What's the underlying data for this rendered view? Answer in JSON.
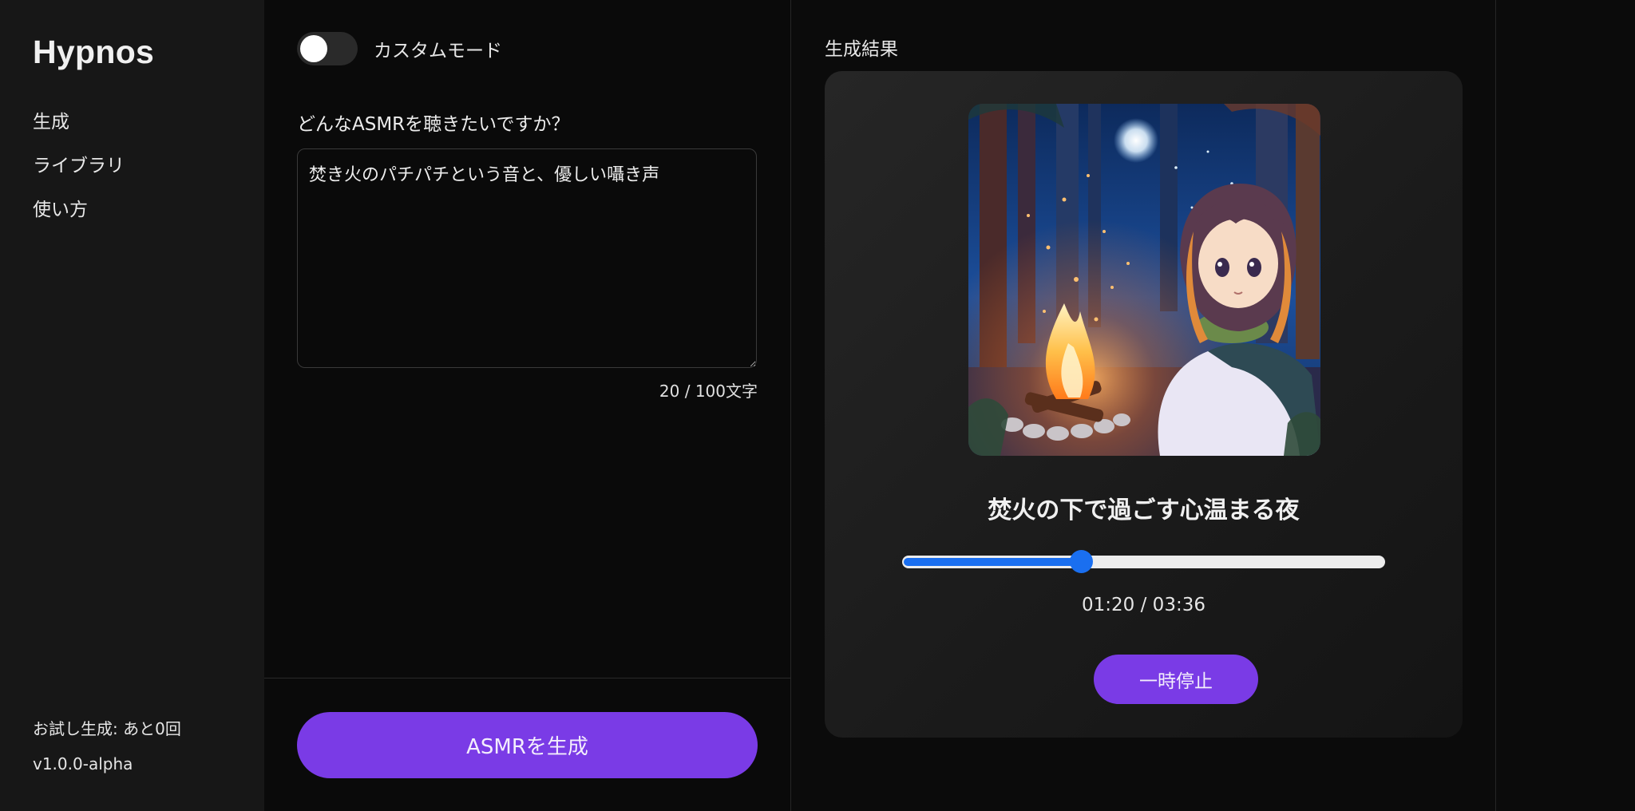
{
  "sidebar": {
    "brand": "Hypnos",
    "nav": [
      {
        "label": "生成"
      },
      {
        "label": "ライブラリ"
      },
      {
        "label": "使い方"
      }
    ],
    "trial_status": "お試し生成: あと0回",
    "version": "v1.0.0-alpha"
  },
  "input": {
    "custom_mode_label": "カスタムモード",
    "custom_mode_on": false,
    "prompt_label": "どんなASMRを聴きたいですか？",
    "prompt_value": "焚き火のパチパチという音と、優しい囁き声",
    "char_count": "20 / 100文字",
    "generate_label": "ASMRを生成"
  },
  "result": {
    "heading": "生成結果",
    "cover_icon": "campfire-girl-illustration",
    "track_title": "焚火の下で過ごす心温まる夜",
    "elapsed": "01:20",
    "duration": "03:36",
    "time_display": "01:20 / 03:36",
    "progress_fraction": 0.37,
    "pause_label": "一時停止"
  },
  "colors": {
    "accent_purple": "#7a3be6",
    "progress_blue": "#1a6ff0",
    "sidebar_bg": "#171717",
    "page_bg": "#0b0b0b"
  }
}
